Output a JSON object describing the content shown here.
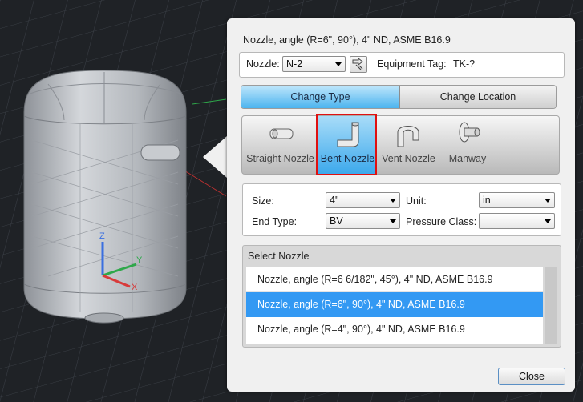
{
  "dialog": {
    "title": "Nozzle, angle (R=6\", 90°), 4\" ND, ASME B16.9",
    "nozzle_label": "Nozzle:",
    "nozzle_value": "N-2",
    "equipment_tag_label": "Equipment Tag:",
    "equipment_tag_value": "TK-?",
    "tabs": [
      {
        "label": "Change Type",
        "active": true
      },
      {
        "label": "Change Location",
        "active": false
      }
    ],
    "types": [
      {
        "label": "Straight Nozzle",
        "icon": "straight-nozzle-icon",
        "selected": false
      },
      {
        "label": "Bent Nozzle",
        "icon": "bent-nozzle-icon",
        "selected": true
      },
      {
        "label": "Vent Nozzle",
        "icon": "vent-nozzle-icon",
        "selected": false
      },
      {
        "label": "Manway",
        "icon": "manway-icon",
        "selected": false
      }
    ],
    "size_label": "Size:",
    "size_value": "4\"",
    "unit_label": "Unit:",
    "unit_value": "in",
    "end_type_label": "End Type:",
    "end_type_value": "BV",
    "pressure_class_label": "Pressure Class:",
    "pressure_class_value": "",
    "select_title": "Select Nozzle",
    "nozzles": [
      {
        "label": "Nozzle, angle (R=6 6/182\", 45°), 4\" ND, ASME B16.9",
        "selected": false
      },
      {
        "label": "Nozzle, angle (R=6\", 90°), 4\" ND, ASME B16.9",
        "selected": true
      },
      {
        "label": "Nozzle, angle (R=4\", 90°), 4\" ND, ASME B16.9",
        "selected": false
      }
    ],
    "close_label": "Close"
  },
  "viewport": {
    "axis_labels": [
      "Z",
      "Y",
      "X"
    ]
  },
  "colors": {
    "accent": "#3399f3",
    "highlight": "#e01010",
    "background": "#1f2226"
  }
}
